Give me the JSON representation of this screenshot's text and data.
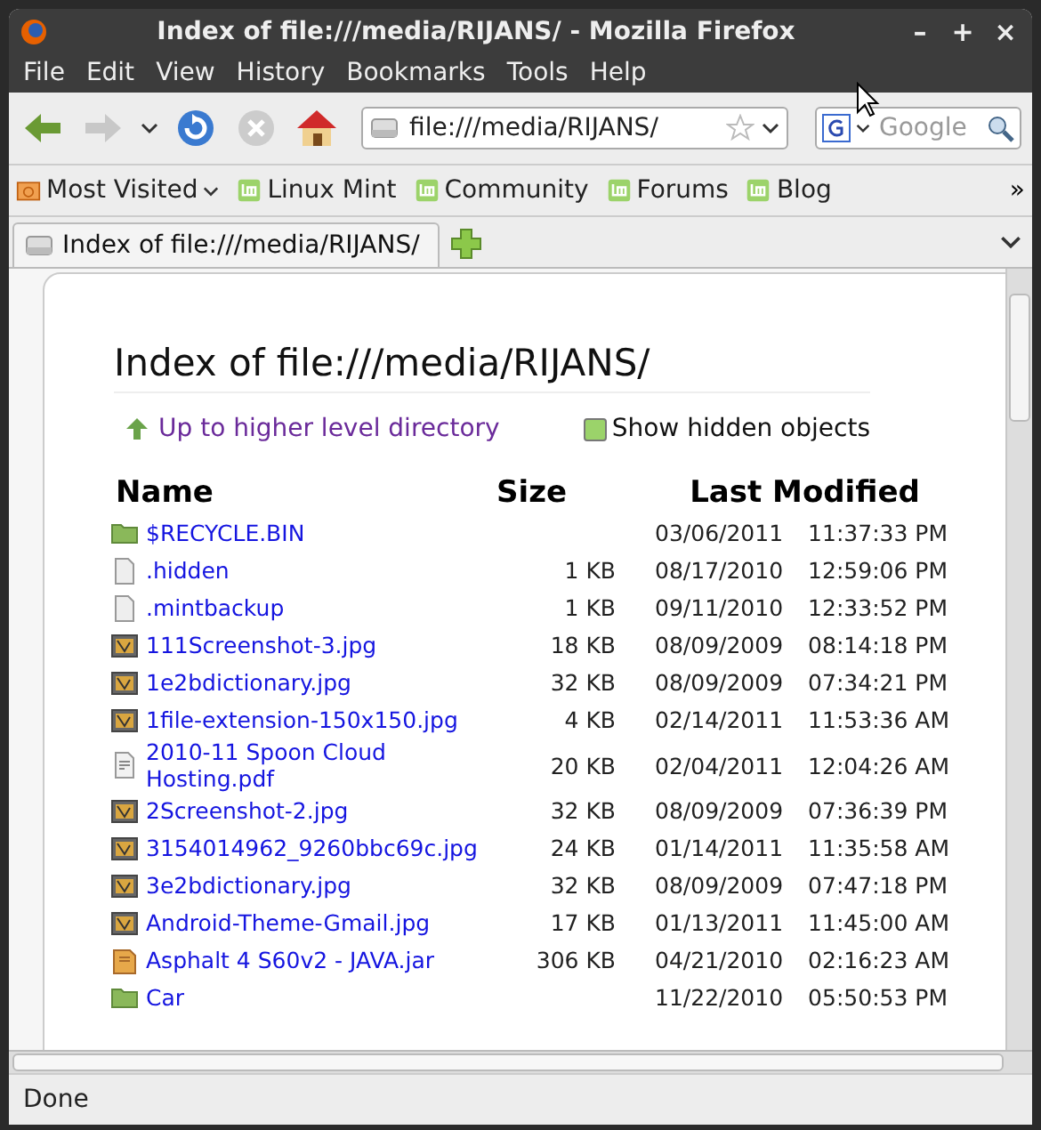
{
  "window": {
    "title": "Index of file:///media/RIJANS/ - Mozilla Firefox",
    "controls": [
      "–",
      "+",
      "×"
    ]
  },
  "menu": [
    "File",
    "Edit",
    "View",
    "History",
    "Bookmarks",
    "Tools",
    "Help"
  ],
  "address": {
    "value": "file:///media/RIJANS/"
  },
  "search": {
    "placeholder": "Google"
  },
  "bookmarks": [
    {
      "label": "Most Visited",
      "kind": "folder"
    },
    {
      "label": "Linux Mint",
      "kind": "link"
    },
    {
      "label": "Community",
      "kind": "link"
    },
    {
      "label": "Forums",
      "kind": "link"
    },
    {
      "label": "Blog",
      "kind": "link"
    }
  ],
  "bookmarks_overflow": "»",
  "tabs": [
    {
      "label": "Index of file:///media/RIJANS/",
      "selected": true
    }
  ],
  "page": {
    "heading": "Index of file:///media/RIJANS/",
    "up_link": "Up to higher level directory",
    "show_hidden": {
      "label": "Show hidden objects",
      "checked": true
    },
    "columns": [
      "Name",
      "Size",
      "Last Modified"
    ],
    "rows": [
      {
        "kind": "folder",
        "name": "$RECYCLE.BIN",
        "date": "03/06/2011",
        "time": "11:37:33 PM"
      },
      {
        "kind": "file",
        "name": ".hidden",
        "size": "1 KB",
        "date": "08/17/2010",
        "time": "12:59:06 PM"
      },
      {
        "kind": "file",
        "name": ".mintbackup",
        "size": "1 KB",
        "date": "09/11/2010",
        "time": "12:33:52 PM"
      },
      {
        "kind": "image",
        "name": "111Screenshot-3.jpg",
        "size": "18 KB",
        "date": "08/09/2009",
        "time": "08:14:18 PM"
      },
      {
        "kind": "image",
        "name": "1e2bdictionary.jpg",
        "size": "32 KB",
        "date": "08/09/2009",
        "time": "07:34:21 PM"
      },
      {
        "kind": "image",
        "name": "1file-extension-150x150.jpg",
        "size": "4 KB",
        "date": "02/14/2011",
        "time": "11:53:36 AM"
      },
      {
        "kind": "document",
        "name": "2010-11 Spoon Cloud Hosting.pdf",
        "size": "20 KB",
        "date": "02/04/2011",
        "time": "12:04:26 AM"
      },
      {
        "kind": "image",
        "name": "2Screenshot-2.jpg",
        "size": "32 KB",
        "date": "08/09/2009",
        "time": "07:36:39 PM"
      },
      {
        "kind": "image",
        "name": "3154014962_9260bbc69c.jpg",
        "size": "24 KB",
        "date": "01/14/2011",
        "time": "11:35:58 AM"
      },
      {
        "kind": "image",
        "name": "3e2bdictionary.jpg",
        "size": "32 KB",
        "date": "08/09/2009",
        "time": "07:47:18 PM"
      },
      {
        "kind": "image",
        "name": "Android-Theme-Gmail.jpg",
        "size": "17 KB",
        "date": "01/13/2011",
        "time": "11:45:00 AM"
      },
      {
        "kind": "archive",
        "name": "Asphalt 4 S60v2 - JAVA.jar",
        "size": "306 KB",
        "date": "04/21/2010",
        "time": "02:16:23 AM"
      },
      {
        "kind": "folder",
        "name": "Car",
        "date": "11/22/2010",
        "time": "05:50:53 PM"
      }
    ]
  },
  "status_bar": "Done"
}
